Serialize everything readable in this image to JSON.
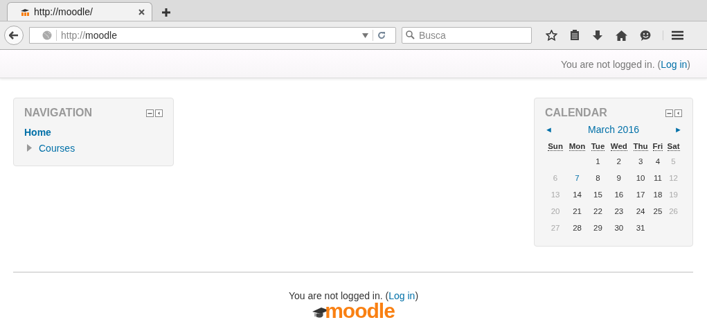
{
  "browser": {
    "tab": {
      "title": "http://moodle/",
      "selected": true
    },
    "address": {
      "scheme": "http://",
      "host": "moodle"
    },
    "search": {
      "placeholder": "Busca"
    }
  },
  "header": {
    "login_notice": {
      "before": "You are not logged in. (",
      "link": "Log in",
      "after": ")"
    }
  },
  "navigation": {
    "title": "NAVIGATION",
    "items": [
      {
        "label": "Home",
        "kind": "current"
      },
      {
        "label": "Courses",
        "kind": "branch",
        "expanded": false
      }
    ]
  },
  "calendar": {
    "title": "CALENDAR",
    "prev": "◄",
    "month": "March 2016",
    "next": "►",
    "weekdays": [
      "Sun",
      "Mon",
      "Tue",
      "Wed",
      "Thu",
      "Fri",
      "Sat"
    ],
    "weeks": [
      [
        {
          "day": "1",
          "kind": "weekday"
        },
        {
          "day": "2",
          "kind": "weekday"
        },
        {
          "day": "3",
          "kind": "weekday"
        },
        {
          "day": "4",
          "kind": "weekday"
        },
        {
          "day": "5",
          "kind": "weekend"
        }
      ],
      [
        {
          "day": "6",
          "kind": "weekend"
        },
        {
          "day": "7",
          "kind": "event"
        },
        {
          "day": "8",
          "kind": "weekday"
        },
        {
          "day": "9",
          "kind": "weekday"
        },
        {
          "day": "10",
          "kind": "weekday"
        },
        {
          "day": "11",
          "kind": "weekday"
        },
        {
          "day": "12",
          "kind": "weekend"
        }
      ],
      [
        {
          "day": "13",
          "kind": "weekend"
        },
        {
          "day": "14",
          "kind": "weekday"
        },
        {
          "day": "15",
          "kind": "weekday"
        },
        {
          "day": "16",
          "kind": "weekday"
        },
        {
          "day": "17",
          "kind": "weekday"
        },
        {
          "day": "18",
          "kind": "weekday"
        },
        {
          "day": "19",
          "kind": "weekend"
        }
      ],
      [
        {
          "day": "20",
          "kind": "weekend"
        },
        {
          "day": "21",
          "kind": "weekday"
        },
        {
          "day": "22",
          "kind": "weekday"
        },
        {
          "day": "23",
          "kind": "weekday"
        },
        {
          "day": "24",
          "kind": "weekday"
        },
        {
          "day": "25",
          "kind": "weekday"
        },
        {
          "day": "26",
          "kind": "weekend"
        }
      ],
      [
        {
          "day": "27",
          "kind": "weekend"
        },
        {
          "day": "28",
          "kind": "weekday"
        },
        {
          "day": "29",
          "kind": "weekday"
        },
        {
          "day": "30",
          "kind": "weekday"
        },
        {
          "day": "31",
          "kind": "weekday"
        }
      ]
    ]
  },
  "footer": {
    "login_notice": {
      "before": "You are not logged in. (",
      "link": "Log in",
      "after": ")"
    },
    "logo_text": "moodle"
  }
}
